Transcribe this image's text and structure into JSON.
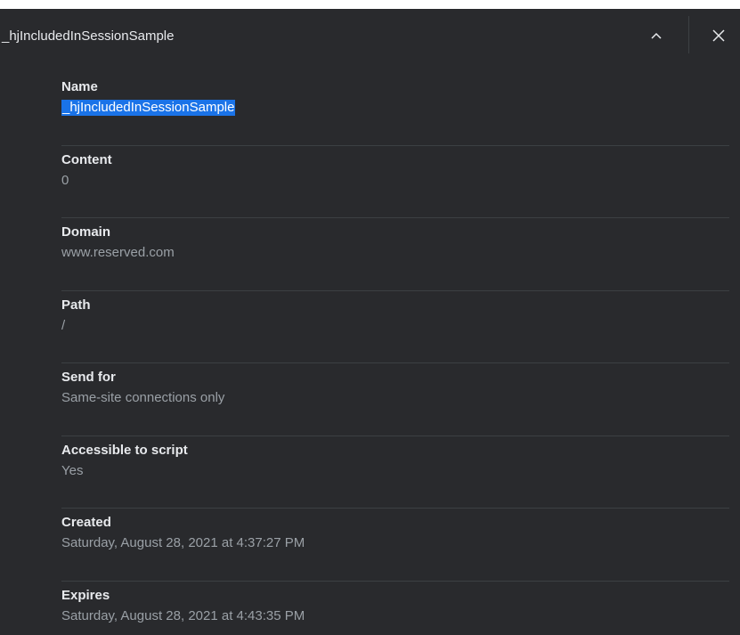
{
  "header": {
    "title": "_hjIncludedInSessionSample"
  },
  "fields": [
    {
      "label": "Name",
      "value": "_hjIncludedInSessionSample"
    },
    {
      "label": "Content",
      "value": "0"
    },
    {
      "label": "Domain",
      "value": "www.reserved.com"
    },
    {
      "label": "Path",
      "value": "/"
    },
    {
      "label": "Send for",
      "value": "Same-site connections only"
    },
    {
      "label": "Accessible to script",
      "value": "Yes"
    },
    {
      "label": "Created",
      "value": "Saturday, August 28, 2021 at 4:37:27 PM"
    },
    {
      "label": "Expires",
      "value": "Saturday, August 28, 2021 at 4:43:35 PM"
    }
  ],
  "colors": {
    "panel_background": "#292a2d",
    "label_text": "#e8eaed",
    "value_text": "#9aa0a6",
    "selection": "#1a73e8",
    "divider": "#3c4043"
  },
  "icons": {
    "collapse": "chevron-up-icon",
    "close": "close-icon"
  }
}
